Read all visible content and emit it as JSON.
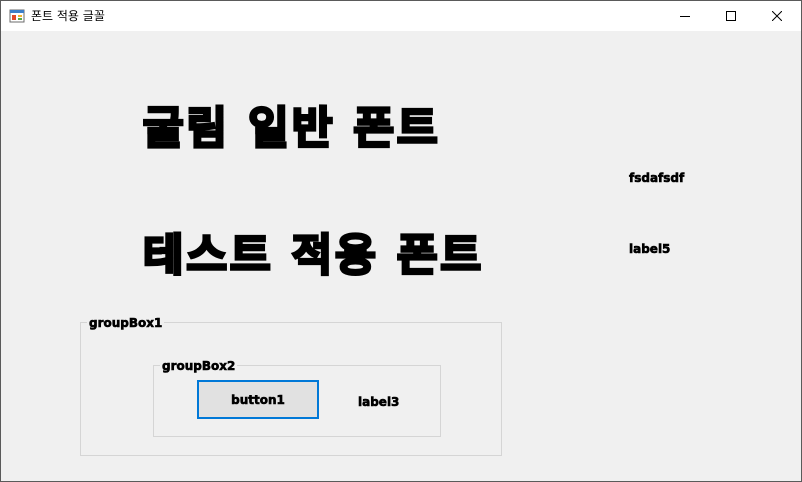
{
  "window": {
    "title": "폰트 적용 글꼴",
    "icon": "winforms-app-icon",
    "controls": [
      "minimize-icon",
      "maximize-icon",
      "close-icon"
    ]
  },
  "labels": {
    "heading1": "굴림 일반 폰트",
    "heading2": "테스트 적용 폰트",
    "label_fsdafsdf": "fsdafsdf",
    "label5": "label5",
    "label3": "label3"
  },
  "groupBox1": {
    "caption": "groupBox1"
  },
  "groupBox2": {
    "caption": "groupBox2"
  },
  "button1": {
    "label": "button1"
  },
  "colors": {
    "window_bg": "#f0f0f0",
    "titlebar_bg": "#ffffff",
    "button_focus_border": "#0078d7",
    "button_bg": "#e1e1e1",
    "groupbox_border": "#d5d5d5"
  }
}
